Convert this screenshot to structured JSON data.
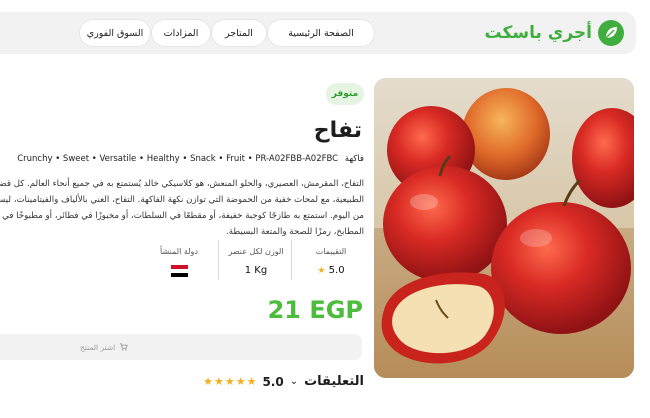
{
  "brand": {
    "name": "أجري باسكت",
    "logo_icon": "leaf-icon",
    "color": "#3fae3f"
  },
  "nav": {
    "items": [
      "الصفحة الرئيسية",
      "المتاجر",
      "المزادات",
      "السوق الفوري"
    ]
  },
  "product": {
    "availability": "متوفر",
    "title": "تفاح",
    "category_label": "فاكهة",
    "tags_line": "Crunchy • Sweet • Versatile • Healthy • Snack • Fruit • PR-A02FBB-A02FBC",
    "description_lines": [
      "التفاح، المقرمش، العصيري، والحلو المنعش، هو كلاسيكي خالد يُستمتع به في جميع أنحاء العالم. كل قضمة تق",
      "الطبيعية، مع لمحات خفية من الحموضة التي توازن نكهة الفاكهة. التفاح، الغني بالألياف والفيتامينات، ليس لذي",
      "من اليوم. استمتع به طازجًا كوجبة خفيفة، أو مقطعًا في السلطات، أو مخبوزًا في فطائر، أو مطبوخًا في كومبو",
      "المطابخ، رمزًا للصحة والمتعة البسيطة."
    ],
    "stats": {
      "rating_label": "التقييمات",
      "rating_value": "5.0",
      "weight_label": "الوزن لكل عنصر",
      "weight_value": "1 Kg",
      "origin_label": "دولة المنشأ",
      "origin_flag": "egypt-flag-icon"
    },
    "price": "21 EGP",
    "report_label": "اشتر المنتج",
    "accent_color": "#4bbc3b"
  },
  "reviews": {
    "label": "التعليقات",
    "score": "5.0",
    "stars": 5,
    "star_color": "#f2b01e"
  }
}
